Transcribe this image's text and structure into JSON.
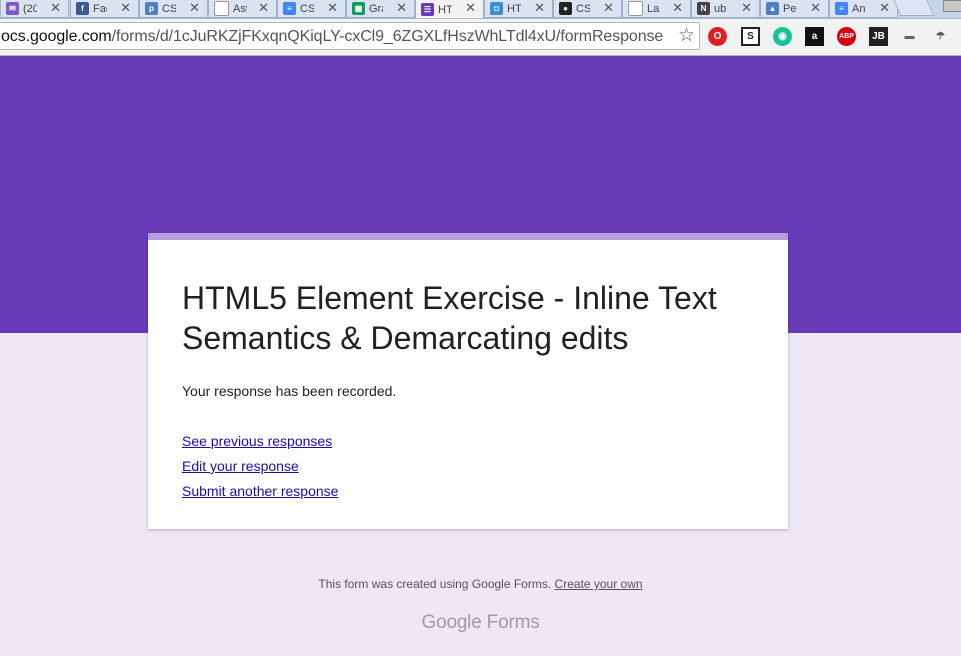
{
  "browser": {
    "tabs": [
      {
        "label": "(20",
        "icon": "gmail-icon",
        "color": "#7b5ac8",
        "glyph": "✉"
      },
      {
        "label": "Fac",
        "icon": "facebook-icon",
        "color": "#3b5998",
        "glyph": "f"
      },
      {
        "label": "CS",
        "icon": "piazza-icon",
        "color": "#4f7fbf",
        "glyph": "p"
      },
      {
        "label": "Ast",
        "icon": "loading-icon",
        "color": "#ffffff",
        "glyph": ""
      },
      {
        "label": "CS",
        "icon": "docs-icon",
        "color": "#4285f4",
        "glyph": "≡"
      },
      {
        "label": "Gra",
        "icon": "sheets-icon",
        "color": "#0f9d58",
        "glyph": "▦"
      },
      {
        "label": "HT",
        "icon": "forms-icon",
        "color": "#673ab7",
        "glyph": "☰",
        "active": true
      },
      {
        "label": "HT",
        "icon": "chat-icon",
        "color": "#3a8fd8",
        "glyph": "◘"
      },
      {
        "label": "CS",
        "icon": "github-icon",
        "color": "#222222",
        "glyph": "●"
      },
      {
        "label": "La",
        "icon": "page-icon",
        "color": "#ffffff",
        "glyph": ""
      },
      {
        "label": "ub",
        "icon": "n-icon",
        "color": "#444444",
        "glyph": "N"
      },
      {
        "label": "Pe",
        "icon": "contacts-icon",
        "color": "#4a7fc1",
        "glyph": "▲"
      },
      {
        "label": "An",
        "icon": "docs-icon",
        "color": "#4285f4",
        "glyph": "≡"
      }
    ],
    "close_glyph": "✕",
    "url_host": "ocs.google.com",
    "url_path": "/forms/d/1cJuRKZjFKxqnQKiqLY-cxCl9_6ZGXLfHszWhLTdl4xU/formResponse",
    "star_glyph": "☆",
    "extensions": [
      {
        "name": "opera-icon",
        "label": "O",
        "bg": "#e02020",
        "fg": "#ffffff",
        "round": true
      },
      {
        "name": "s-extension-icon",
        "label": "S",
        "bg": "#ffffff",
        "fg": "#222222",
        "round": false
      },
      {
        "name": "grammarly-icon",
        "label": "◉",
        "bg": "#15c39a",
        "fg": "#ffffff",
        "round": true
      },
      {
        "name": "amazon-icon",
        "label": "a",
        "bg": "#111111",
        "fg": "#ffffff",
        "round": false
      },
      {
        "name": "adblock-icon",
        "label": "ABP",
        "bg": "#d8000c",
        "fg": "#ffffff",
        "round": true
      },
      {
        "name": "jb-icon",
        "label": "JB",
        "bg": "#222222",
        "fg": "#ffffff",
        "round": false
      },
      {
        "name": "bookmark-icon",
        "label": "▬",
        "bg": "#f2f2f2",
        "fg": "#666666",
        "round": false
      },
      {
        "name": "palm-icon",
        "label": "☂",
        "bg": "#f2f2f2",
        "fg": "#555555",
        "round": false
      }
    ]
  },
  "form": {
    "title": "HTML5 Element Exercise - Inline Text Semantics & Demarcating edits",
    "confirmation": "Your response has been recorded.",
    "links": {
      "previous": "See previous responses",
      "edit": "Edit your response",
      "another": "Submit another response"
    }
  },
  "footer": {
    "created_text": "This form was created using Google Forms.",
    "create_link": "Create your own",
    "logo_google": "Google",
    "logo_forms": "Forms"
  },
  "colors": {
    "banner": "#673ab7",
    "accent_bar": "#b39ddb",
    "page_bg": "#ede7f6",
    "link": "#1a0dab"
  }
}
